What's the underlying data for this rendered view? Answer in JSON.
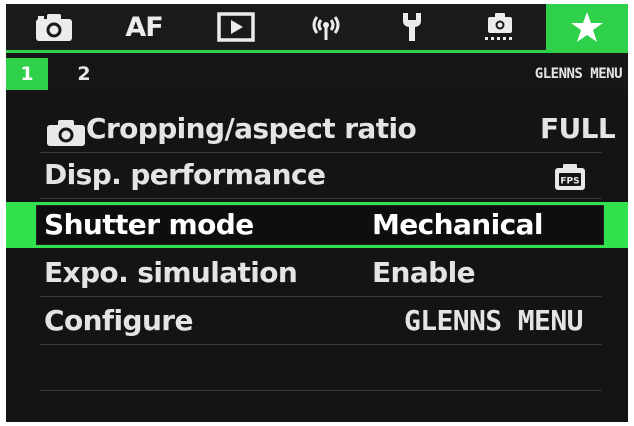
{
  "tabs": [
    {
      "id": "shooting",
      "icon": "camera-icon",
      "label": ""
    },
    {
      "id": "af",
      "icon": "",
      "label": "AF"
    },
    {
      "id": "playback",
      "icon": "play-icon",
      "label": ""
    },
    {
      "id": "wireless",
      "icon": "wireless-icon",
      "label": ""
    },
    {
      "id": "setup",
      "icon": "wrench-icon",
      "label": ""
    },
    {
      "id": "custom",
      "icon": "custom-function-icon",
      "label": ""
    },
    {
      "id": "my-menu",
      "icon": "star-icon",
      "label": "",
      "active": true
    }
  ],
  "subtabs": [
    {
      "label": "1",
      "active": true
    },
    {
      "label": "2",
      "active": false
    }
  ],
  "menu_name": "GLENNS MENU",
  "items": [
    {
      "label": "Cropping/aspect ratio",
      "value": "FULL",
      "icon": "camera-icon"
    },
    {
      "label": "Disp. performance",
      "value": "",
      "icon": "fps-icon"
    },
    {
      "label": "Shutter mode",
      "value": "Mechanical",
      "selected": true
    },
    {
      "label": "Expo. simulation",
      "value": "Enable"
    },
    {
      "label": "Configure",
      "value": "GLENNS MENU"
    }
  ],
  "colors": {
    "accent": "#2fd04a",
    "background": "#141414",
    "text": "#e4e4e4"
  }
}
